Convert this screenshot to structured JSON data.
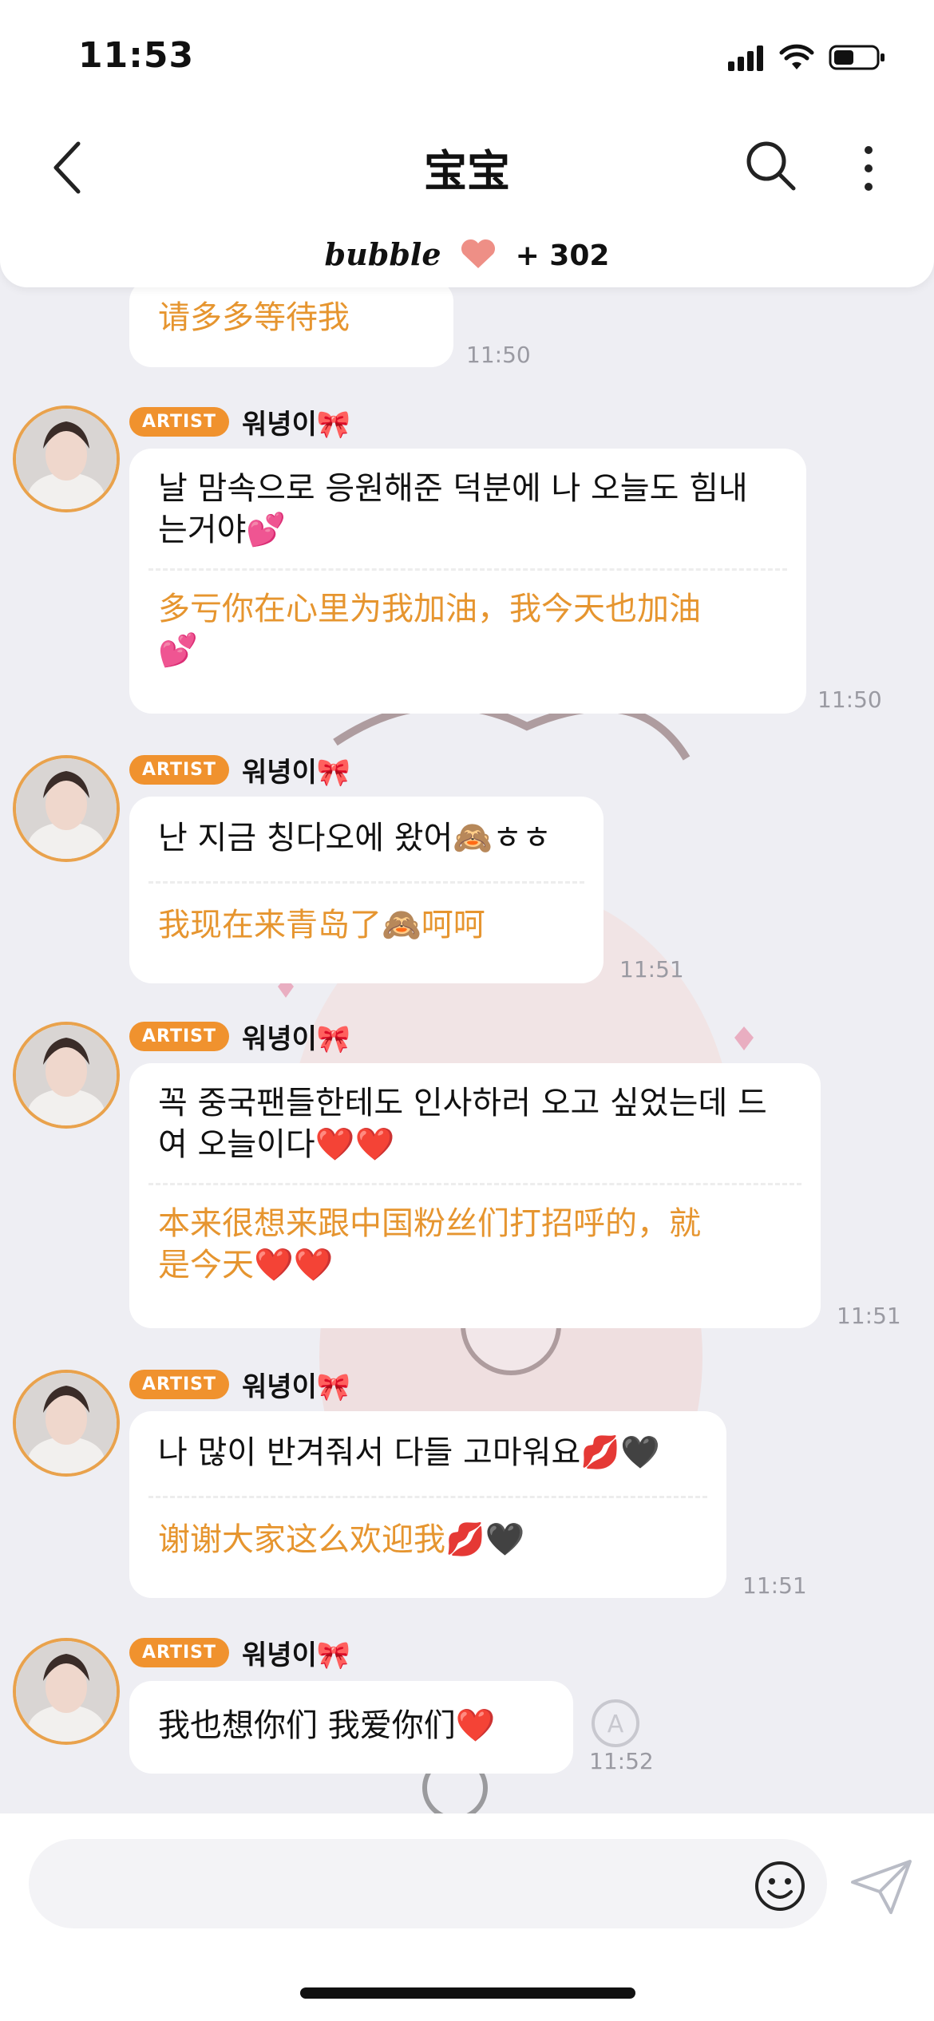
{
  "status_bar": {
    "time": "11:53"
  },
  "header": {
    "title": "宝宝",
    "bubble_brand": "bubble",
    "bubble_count": "+ 302"
  },
  "icons": {
    "back": "chevron-left-icon",
    "search": "search-icon",
    "more": "more-vertical-icon",
    "emoji": "smiley-icon",
    "send": "paper-plane-icon",
    "translate": "translate-refresh-icon"
  },
  "colors": {
    "accent_orange": "#e6952f",
    "badge_orange": "#f0922e",
    "background": "#eeeef3"
  },
  "messages": [
    {
      "zh": "请多多等待我",
      "time": "11:50"
    },
    {
      "badge": "ARTIST",
      "name": "워녕이🎀",
      "ko_lines": [
        "날 맘속으로 응원해준 덕분에 나 오늘도 힘내",
        "는거야💕"
      ],
      "zh_lines": [
        "多亏你在心里为我加油，我今天也加油",
        "💕"
      ],
      "time": "11:50"
    },
    {
      "badge": "ARTIST",
      "name": "워녕이🎀",
      "ko_lines": [
        "난 지금 칭다오에 왔어🙈ㅎㅎ"
      ],
      "zh_lines": [
        "我现在来青岛了🙈呵呵"
      ],
      "time": "11:51"
    },
    {
      "badge": "ARTIST",
      "name": "워녕이🎀",
      "ko_lines": [
        "꼭 중국팬들한테도 인사하러 오고 싶었는데 드",
        "여 오늘이다❤️❤️"
      ],
      "zh_lines": [
        "本来很想来跟中国粉丝们打招呼的，就",
        "是今天❤️❤️"
      ],
      "time": "11:51"
    },
    {
      "badge": "ARTIST",
      "name": "워녕이🎀",
      "ko_lines": [
        "나 많이 반겨줘서 다들 고마워요💋🖤"
      ],
      "zh_lines": [
        "谢谢大家这么欢迎我💋🖤"
      ],
      "time": "11:51"
    },
    {
      "badge": "ARTIST",
      "name": "워녕이🎀",
      "ko_lines": [
        "我也想你们 我爱你们❤️"
      ],
      "time": "11:52"
    }
  ]
}
